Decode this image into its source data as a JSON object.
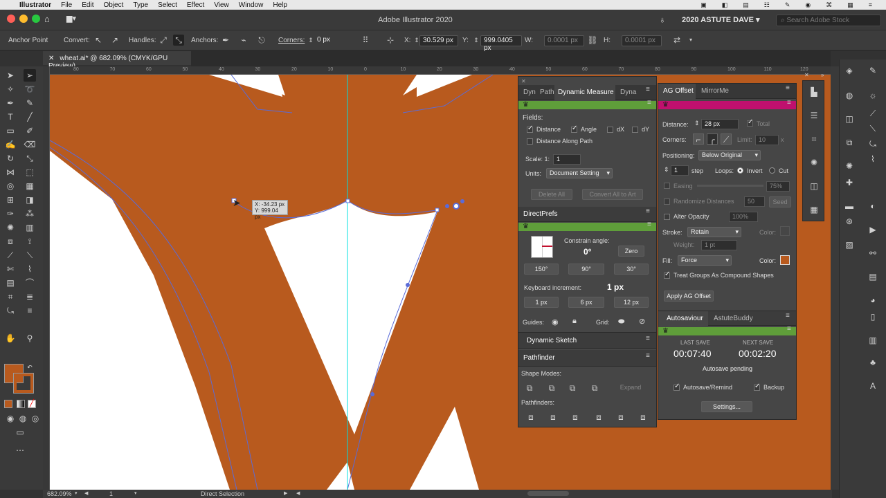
{
  "menubar": {
    "apple": "",
    "items": [
      "Illustrator",
      "File",
      "Edit",
      "Object",
      "Type",
      "Select",
      "Effect",
      "View",
      "Window",
      "Help"
    ]
  },
  "titlebar": {
    "title": "Adobe Illustrator 2020",
    "workspace": "2020 ASTUTE DAVE",
    "search_placeholder": "Search Adobe Stock"
  },
  "control": {
    "mode": "Anchor Point",
    "convert": "Convert:",
    "handles": "Handles:",
    "anchors": "Anchors:",
    "corners": "Corners:",
    "corner_value": "0 px",
    "x_label": "X:",
    "x_value": "30.529 px",
    "y_label": "Y:",
    "y_value": "999.0405 px",
    "w_label": "W:",
    "w_value": "0.0001 px",
    "h_label": "H:",
    "h_value": "0.0001 px"
  },
  "document": {
    "tab": "wheat.ai* @ 682.09% (CMYK/GPU Preview)",
    "ruler_ticks": [
      "80",
      "70",
      "60",
      "50",
      "40",
      "30",
      "20",
      "10",
      "0",
      "10",
      "20",
      "30",
      "40",
      "50",
      "60",
      "70",
      "80",
      "90",
      "100",
      "110",
      "120"
    ],
    "fill_color": "#b85a1e",
    "tooltip_x": "X: -34.23 px",
    "tooltip_y": "Y: 999.04 px"
  },
  "status": {
    "zoom": "682.09%",
    "artboard": "1",
    "tool": "Direct Selection"
  },
  "dyn_panel": {
    "tabs": [
      "Dyn",
      "Path",
      "Dynamic Measure",
      "Dyna"
    ],
    "fields_label": "Fields:",
    "distance": "Distance",
    "angle": "Angle",
    "dx": "dX",
    "dy": "dY",
    "distance_along_path": "Distance Along Path",
    "scale_label": "Scale: 1:",
    "scale_value": "1",
    "units_label": "Units:",
    "units_value": "Document Setting",
    "delete_all": "Delete All",
    "convert_all": "Convert All to Art"
  },
  "directprefs": {
    "title": "DirectPrefs",
    "constrain_label": "Constrain angle:",
    "constrain_value": "0°",
    "zero": "Zero",
    "angles": [
      "150°",
      "90°",
      "30°"
    ],
    "kbd_label": "Keyboard increment:",
    "kbd_value": "1 px",
    "increments": [
      "1 px",
      "6 px",
      "12 px"
    ],
    "guides": "Guides:",
    "grid": "Grid:"
  },
  "dynamic_sketch": {
    "title": "Dynamic Sketch"
  },
  "pathfinder": {
    "title": "Pathfinder",
    "shape_modes": "Shape Modes:",
    "expand": "Expand",
    "pathfinders": "Pathfinders:"
  },
  "ag_offset": {
    "tabs": [
      "AG Offset",
      "MirrorMe"
    ],
    "distance_label": "Distance:",
    "distance_value": "28 px",
    "total": "Total",
    "corners_label": "Corners:",
    "limit_label": "Limit:",
    "limit_value": "10",
    "limit_x": "x",
    "positioning_label": "Positioning:",
    "positioning_value": "Below Original",
    "steps_value": "1",
    "step": "step",
    "loops": "Loops:",
    "invert": "Invert",
    "cut": "Cut",
    "easing": "Easing",
    "easing_value": "75%",
    "randomize": "Randomize Distances",
    "rand_value": "50",
    "seed": "Seed",
    "alter_opacity": "Alter Opacity",
    "opacity_value": "100%",
    "stroke_label": "Stroke:",
    "stroke_value": "Retain",
    "color_label": "Color:",
    "weight_label": "Weight:",
    "weight_value": "1 pt",
    "fill_label": "Fill:",
    "fill_value": "Force",
    "fill_color": "#b85a1e",
    "treat_groups": "Treat Groups As Compound Shapes",
    "apply": "Apply AG Offset"
  },
  "autosaviour": {
    "tabs": [
      "Autosaviour",
      "AstuteBuddy"
    ],
    "last_save_label": "LAST SAVE",
    "last_save": "00:07:40",
    "next_save_label": "NEXT SAVE",
    "next_save": "00:02:20",
    "status": "Autosave pending",
    "autosave_remind": "Autosave/Remind",
    "backup": "Backup",
    "settings": "Settings..."
  },
  "colors": {
    "green_strip": "#5f9e3a",
    "magenta_strip": "#c0106e",
    "guide": "#00e0e0",
    "path": "#5a6bd8"
  }
}
